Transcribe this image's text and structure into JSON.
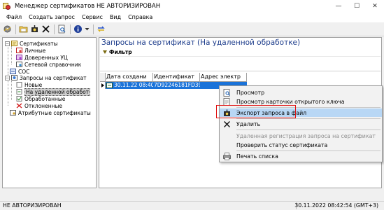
{
  "window": {
    "title": "Менеджер сертификатов  НЕ АВТОРИЗИРОВАН",
    "controls": {
      "minimize": "—",
      "maximize": "☐",
      "close": "✕"
    }
  },
  "menu": [
    "Файл",
    "Создать запрос",
    "Сервис",
    "Вид",
    "Справка"
  ],
  "toolbar": {
    "icons": [
      "gear-icon",
      "open-folder-icon",
      "export-icon",
      "delete-icon",
      "preview-icon",
      "info-icon",
      "dropdown-arrow-icon",
      "refresh-icon"
    ]
  },
  "tree": {
    "nodes": [
      {
        "label": "Сертификаты",
        "expander": "−",
        "icon": "certificate-folder-icon"
      },
      {
        "label": "Личные",
        "icon": "personal-cert-icon"
      },
      {
        "label": "Доверенных УЦ",
        "icon": "trusted-ca-icon"
      },
      {
        "label": "Сетевой справочник",
        "icon": "network-directory-icon"
      },
      {
        "label": "СОС",
        "icon": "crl-icon"
      },
      {
        "label": "Запросы на сертификат",
        "expander": "−",
        "icon": "requests-folder-icon"
      },
      {
        "label": "Новые",
        "icon": "new-request-icon"
      },
      {
        "label": "На удаленной обработ",
        "icon": "remote-processing-icon",
        "selected": true
      },
      {
        "label": "Обработанные",
        "icon": "processed-icon"
      },
      {
        "label": "Отклоненные",
        "icon": "rejected-icon"
      },
      {
        "label": "Атрибутные сертификаты",
        "icon": "attribute-cert-icon"
      }
    ]
  },
  "panel": {
    "title": "Запросы на сертификат (На удаленной обработке)",
    "filter_label": "Фильтр"
  },
  "grid": {
    "columns": [
      "Дата создани",
      "Идентификат",
      "Адрес электр"
    ],
    "rows": [
      {
        "date": "30.11.22 08:40",
        "id": "7D92246181FD39",
        "address": ""
      }
    ]
  },
  "context_menu": {
    "items": [
      {
        "label": "Просмотр",
        "icon": "view-icon",
        "enabled": true
      },
      {
        "label": "Просмотр карточки открытого ключа",
        "icon": "key-card-icon",
        "enabled": true
      },
      {
        "label": "Экспорт запроса в файл",
        "icon": "export-file-icon",
        "enabled": true,
        "highlighted": true
      },
      {
        "label": "Удалить",
        "icon": "delete-icon",
        "enabled": true
      },
      {
        "label": "Удаленная регистрация запроса на сертификат",
        "icon": "",
        "enabled": false
      },
      {
        "label": "Проверить статус сертификата",
        "icon": "",
        "enabled": true
      },
      {
        "label": "Печать списка",
        "icon": "printer-icon",
        "enabled": true
      }
    ],
    "highlight_color": "#b8d7f5",
    "callout_color": "#e01010"
  },
  "status": {
    "left": "НЕ АВТОРИЗИРОВАН",
    "right": "30.11.2022 08:42:54 (GMT+3)"
  }
}
